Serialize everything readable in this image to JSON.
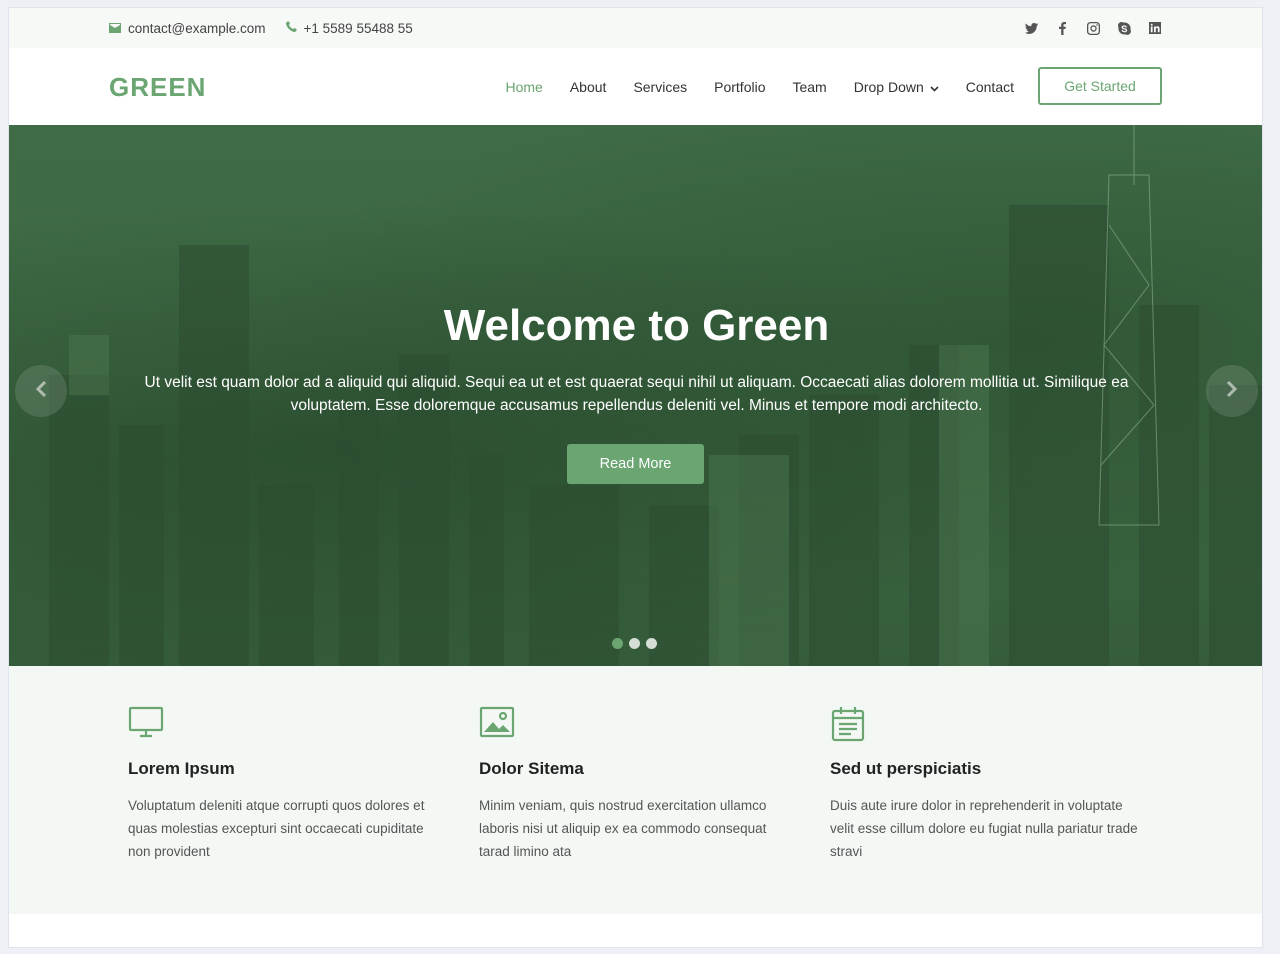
{
  "topbar": {
    "email": "contact@example.com",
    "phone": "+1 5589 55488 55",
    "social_icons": [
      "twitter-icon",
      "facebook-icon",
      "instagram-icon",
      "skype-icon",
      "linkedin-icon"
    ]
  },
  "header": {
    "logo": "GREEN",
    "nav": [
      {
        "label": "Home",
        "active": true
      },
      {
        "label": "About"
      },
      {
        "label": "Services"
      },
      {
        "label": "Portfolio"
      },
      {
        "label": "Team"
      },
      {
        "label": "Drop Down",
        "dropdown": true
      },
      {
        "label": "Contact"
      }
    ],
    "cta": "Get Started"
  },
  "hero": {
    "title": "Welcome to Green",
    "text": "Ut velit est quam dolor ad a aliquid qui aliquid. Sequi ea ut et est quaerat sequi nihil ut aliquam. Occaecati alias dolorem mollitia ut. Similique ea voluptatem. Esse doloremque accusamus repellendus deleniti vel. Minus et tempore modi architecto.",
    "button": "Read More",
    "slides": 3,
    "active_slide": 1
  },
  "features": [
    {
      "icon": "monitor-icon",
      "title": "Lorem Ipsum",
      "text": "Voluptatum deleniti atque corrupti quos dolores et quas molestias excepturi sint occaecati cupiditate non provident"
    },
    {
      "icon": "image-icon",
      "title": "Dolor Sitema",
      "text": "Minim veniam, quis nostrud exercitation ullamco laboris nisi ut aliquip ex ea commodo consequat tarad limino ata"
    },
    {
      "icon": "calendar-icon",
      "title": "Sed ut perspiciatis",
      "text": "Duis aute irure dolor in reprehenderit in voluptate velit esse cillum dolore eu fugiat nulla pariatur trade stravi"
    }
  ],
  "colors": {
    "accent": "#6aa572",
    "hero_overlay": "#3e6944"
  }
}
